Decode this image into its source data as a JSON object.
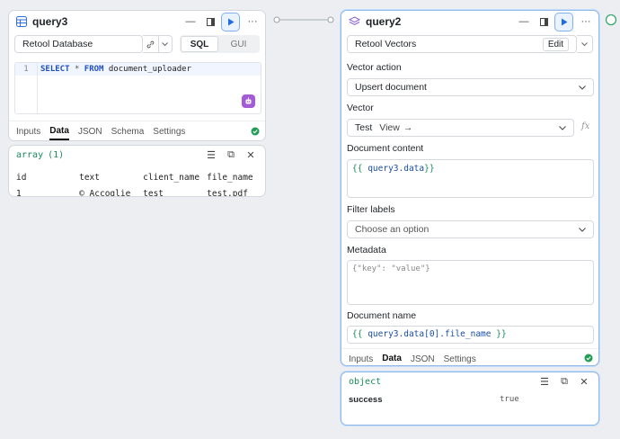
{
  "left_panel": {
    "title": "query3",
    "resource": "Retool Database",
    "mode_tabs": [
      "SQL",
      "GUI"
    ],
    "editor": {
      "line_number": "1",
      "sql_keyword1": "SELECT",
      "sql_star": "*",
      "sql_keyword2": "FROM",
      "sql_table": "document_uploader"
    },
    "bottom_tabs": [
      "Inputs",
      "Data",
      "JSON",
      "Schema",
      "Settings"
    ],
    "active_tab": "Data",
    "status": "success"
  },
  "left_result": {
    "type_label": "array",
    "count": "(1)",
    "columns": [
      "id",
      "text",
      "client_name",
      "file_name"
    ],
    "row": [
      "1",
      "© Accoglie",
      "test",
      "test.pdf"
    ]
  },
  "right_panel": {
    "title": "query2",
    "resource": "Retool Vectors",
    "edit_button": "Edit",
    "vector_action_label": "Vector action",
    "vector_action_value": "Upsert document",
    "vector_label": "Vector",
    "vector_value": "Test",
    "vector_view_link": "View",
    "fx_label": "fx",
    "document_content_label": "Document content",
    "document_content": {
      "open": "{{",
      "obj": "query3",
      "prop": ".data",
      "close": "}}"
    },
    "filter_labels_label": "Filter labels",
    "filter_labels_placeholder": "Choose an option",
    "metadata_label": "Metadata",
    "metadata_placeholder": "{\"key\": \"value\"}",
    "document_name_label": "Document name",
    "document_name": {
      "open": "{{",
      "obj": "query3",
      "mid": ".data[0].",
      "prop": "file_name",
      "close": "}}"
    },
    "bottom_tabs": [
      "Inputs",
      "Data",
      "JSON",
      "Settings"
    ],
    "active_tab": "Data",
    "status": "success"
  },
  "right_result": {
    "type_label": "object",
    "key": "success",
    "value": "true"
  },
  "colors": {
    "accent": "#1e6ce6",
    "success": "#1f9d55",
    "code_green": "#1a8a5c"
  }
}
